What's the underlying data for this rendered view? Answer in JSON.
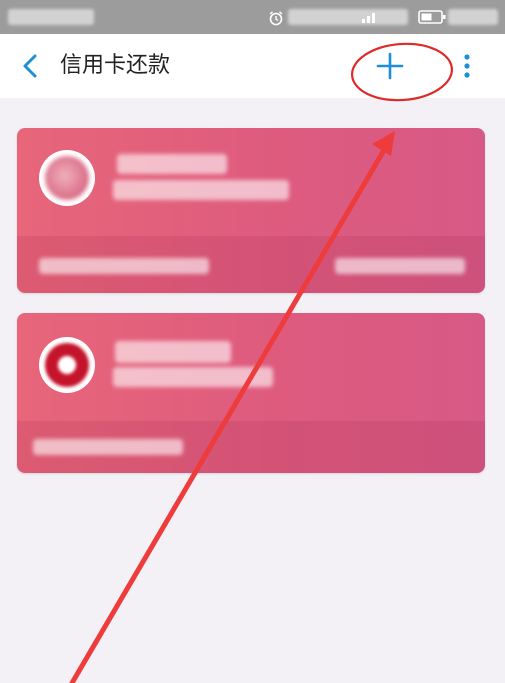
{
  "header": {
    "title": "信用卡还款"
  },
  "icons": {
    "back": "chevron-left-icon",
    "add": "plus-icon",
    "more": "more-vertical-icon"
  },
  "colors": {
    "accent": "#1e8fd6",
    "card_gradient_start": "#e8667a",
    "card_gradient_end": "#d75a86",
    "annotation": "#e02a2a"
  }
}
